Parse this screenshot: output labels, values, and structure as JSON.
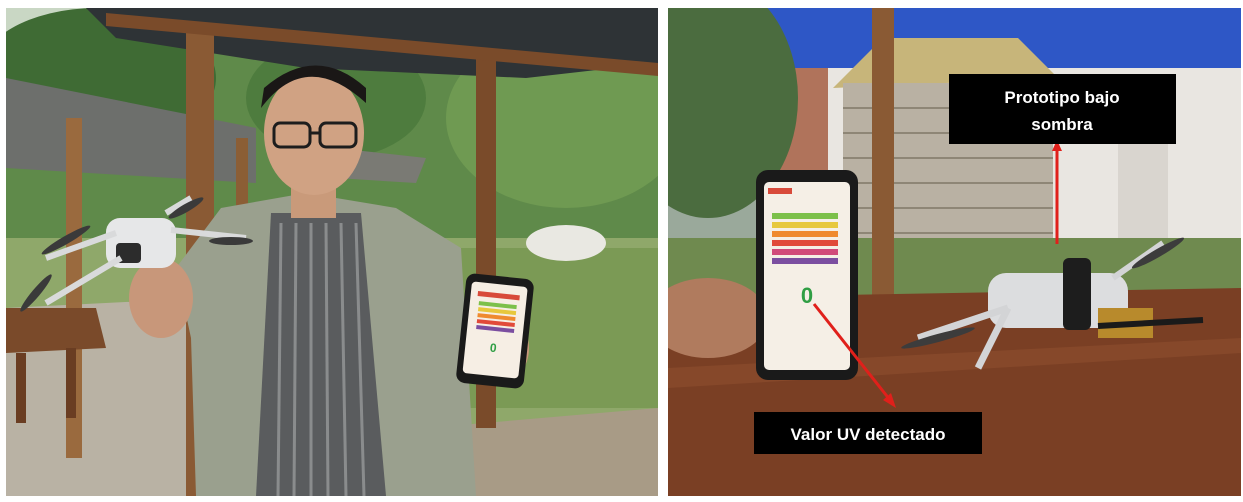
{
  "panels": {
    "left": {
      "phone": {
        "uv_value": "0"
      }
    },
    "right": {
      "phone": {
        "uv_value": "0"
      },
      "callouts": {
        "prototype_line1": "Prototipo bajo",
        "prototype_line2": "sombra",
        "uv_detected": "Valor UV detectado"
      }
    }
  },
  "colors": {
    "callout_bg": "#000000",
    "callout_text": "#ffffff",
    "arrow": "#e0201b",
    "uv_number": "#2f9e44"
  }
}
